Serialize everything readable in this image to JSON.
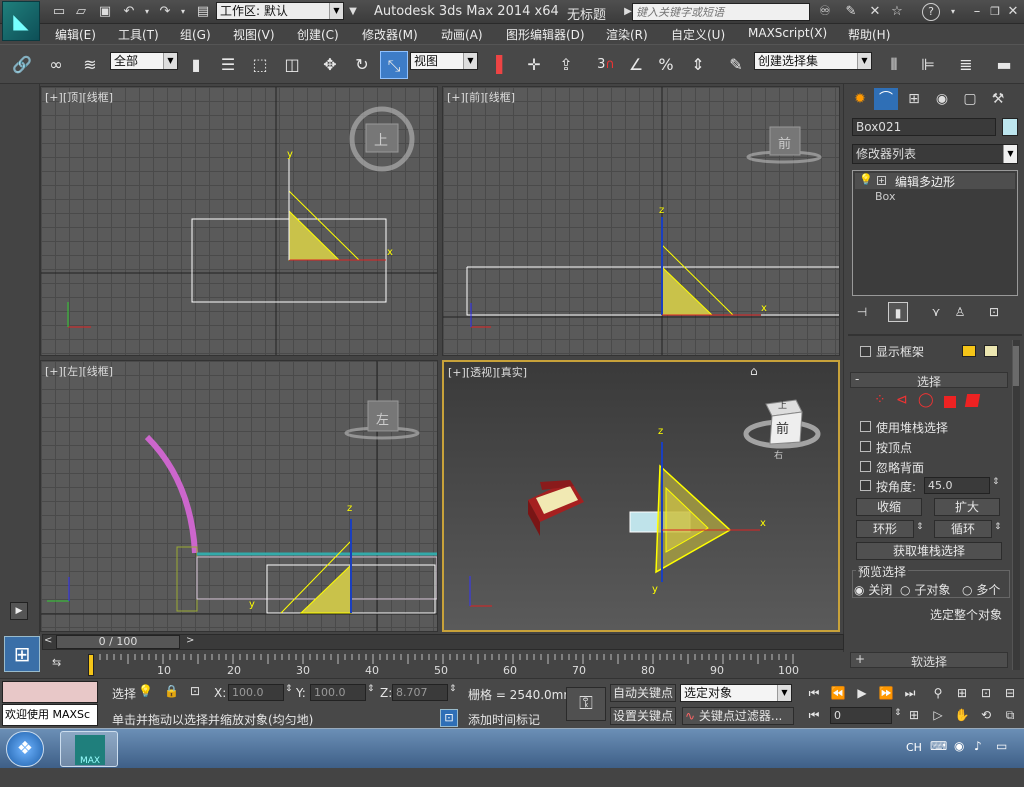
{
  "title": {
    "workspace_label": "工作区: 默认",
    "app_title": "Autodesk 3ds Max  2014 x64",
    "doc_title": "无标题",
    "search_placeholder": "键入关键字或短语"
  },
  "menu": [
    "编辑(E)",
    "工具(T)",
    "组(G)",
    "视图(V)",
    "创建(C)",
    "修改器(M)",
    "动画(A)",
    "图形编辑器(D)",
    "渲染(R)",
    "自定义(U)",
    "MAXScript(X)",
    "帮助(H)"
  ],
  "toolbar": {
    "selection_filter": "全部",
    "ref_coord": "视图",
    "named_selection": "创建选择集",
    "snap_3": "3",
    "percent": "%"
  },
  "viewports": {
    "top": {
      "plus": "[+]",
      "name": "[顶]",
      "shade": "[线框]",
      "cube": "上"
    },
    "front": {
      "plus": "[+]",
      "name": "[前]",
      "shade": "[线框]",
      "cube": "前"
    },
    "left": {
      "plus": "[+]",
      "name": "[左]",
      "shade": "[线框]",
      "cube": "左"
    },
    "persp": {
      "plus": "[+]",
      "name": "[透视]",
      "shade": "[真实]",
      "cube_top": "上",
      "cube_front": "前",
      "cube_side": "右"
    }
  },
  "axes": {
    "x": "x",
    "y": "y",
    "z": "z"
  },
  "cmdpanel": {
    "object_name": "Box021",
    "modifier_list": "修改器列表",
    "stack_items": [
      "编辑多边形",
      "Box"
    ],
    "show_cage": "显示框架",
    "rollout_select": "选择",
    "minus": "-",
    "plus": "+",
    "opt_use_stack": "使用堆栈选择",
    "opt_by_vertex": "按顶点",
    "opt_ignore_back": "忽略背面",
    "opt_by_angle": "按角度:",
    "angle_value": "45.0",
    "btn_shrink": "收缩",
    "btn_grow": "扩大",
    "btn_ring": "环形",
    "btn_loop": "循环",
    "btn_get_stack": "获取堆栈选择",
    "preview_group": "预览选择",
    "radio_off": "关闭",
    "radio_subobj": "子对象",
    "radio_multi": "多个",
    "select_whole": "选定整个对象",
    "rollout_soft": "软选择",
    "accent_color": "#f5c518"
  },
  "timeline": {
    "frame_counter": "0 / 100",
    "ticks": [
      "10",
      "20",
      "30",
      "40",
      "50",
      "60",
      "70",
      "80",
      "90",
      "100"
    ]
  },
  "status": {
    "maxscript_welcome": "欢迎使用 MAXSc",
    "select_label": "选择",
    "x_label": "X:",
    "x_value": "100.0",
    "y_label": "Y:",
    "y_value": "100.0",
    "z_label": "Z:",
    "z_value": "8.707",
    "grid": "栅格 = 2540.0mm",
    "prompt": "单击并拖动以选择并缩放对象(均匀地)",
    "add_time_tag": "添加时间标记",
    "auto_key": "自动关键点",
    "set_key": "设置关键点",
    "key_target": "选定对象",
    "key_filters": "关键点过滤器...",
    "frame_field": "0"
  },
  "taskbar": {
    "app_label": "MAX",
    "lang": "CH"
  }
}
